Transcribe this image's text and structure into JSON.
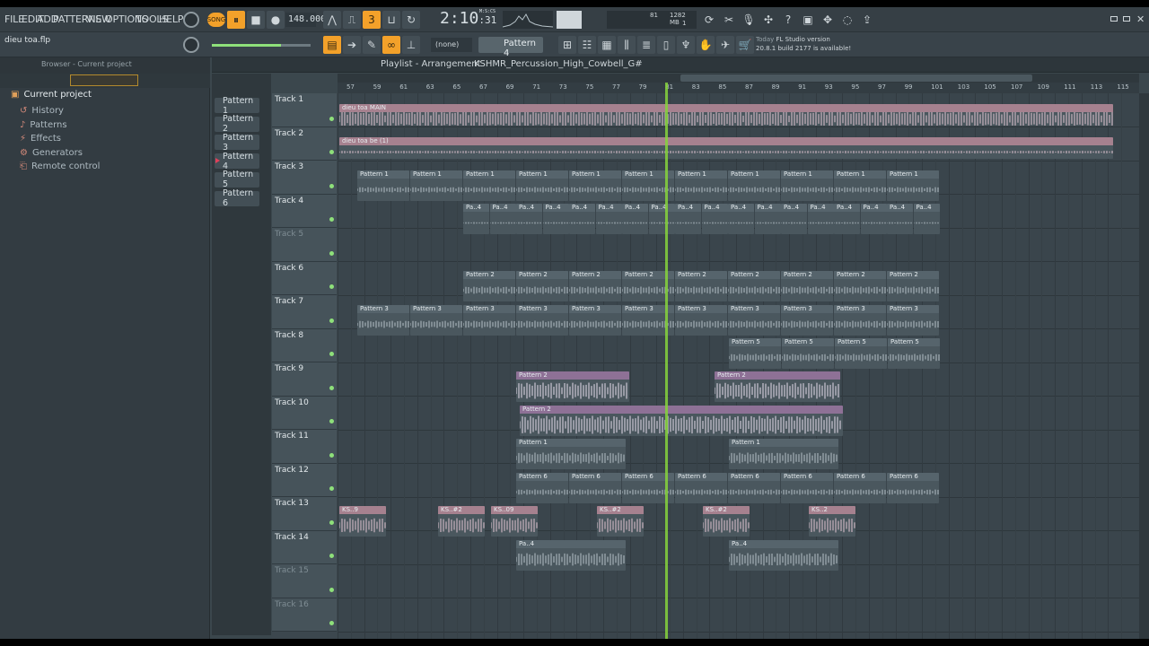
{
  "menu": [
    "FILE",
    "EDIT",
    "ADD",
    "PATTERNS",
    "VIEW",
    "OPTIONS",
    "TOOLS",
    "HELP"
  ],
  "transport": {
    "mode": "SONG",
    "tempo": "148.000",
    "time": "2:10",
    "time_sub": ":31",
    "time_label": "M:S:CS"
  },
  "cpu": {
    "mem": "1282 MB",
    "voices": "81",
    "poly": "1"
  },
  "project_file": "dieu toa.flp",
  "snap": "(none)",
  "pattern_selector": "Pattern 4",
  "hint": {
    "line1_prefix": "Today",
    "line1": "FL Studio version",
    "line2": "20.8.1 build 2177 is available!"
  },
  "browser": {
    "title": "Browser - Current project",
    "root": "Current project",
    "items": [
      "History",
      "Patterns",
      "Effects",
      "Generators",
      "Remote control"
    ]
  },
  "playlist": {
    "title": "Playlist - Arrangement",
    "breadcrumb": "KSHMR_Percussion_High_Cowbell_G#"
  },
  "patterns": [
    "Pattern 1",
    "Pattern 2",
    "Pattern 3",
    "Pattern 4",
    "Pattern 5",
    "Pattern 6"
  ],
  "tracks": [
    "Track 1",
    "Track 2",
    "Track 3",
    "Track 4",
    "Track 5",
    "Track 6",
    "Track 7",
    "Track 8",
    "Track 9",
    "Track 10",
    "Track 11",
    "Track 12",
    "Track 13",
    "Track 14",
    "Track 15",
    "Track 16"
  ],
  "ruler": [
    "57",
    "59",
    "61",
    "63",
    "65",
    "67",
    "69",
    "71",
    "73",
    "75",
    "77",
    "79",
    "81",
    "83",
    "85",
    "87",
    "89",
    "91",
    "93",
    "95",
    "97",
    "99",
    "101",
    "103",
    "105",
    "107",
    "109",
    "111",
    "113",
    "115"
  ],
  "clips": {
    "audio1": "dieu toa MAIN",
    "audio2": "dieu toa be (1)",
    "p1": "Pattern 1",
    "p4": "Pa..4",
    "p2": "Pattern 2",
    "p3": "Pattern 3",
    "p5": "Pattern 5",
    "p6": "Pattern 6",
    "ks9": "KS..9",
    "ks2": "KS..#2",
    "ks09": "KS..09",
    "ks2b": "KS..2"
  },
  "colors": {
    "accent": "#f3a12a",
    "cursor": "#86d23c",
    "led": "#8ee07a"
  }
}
